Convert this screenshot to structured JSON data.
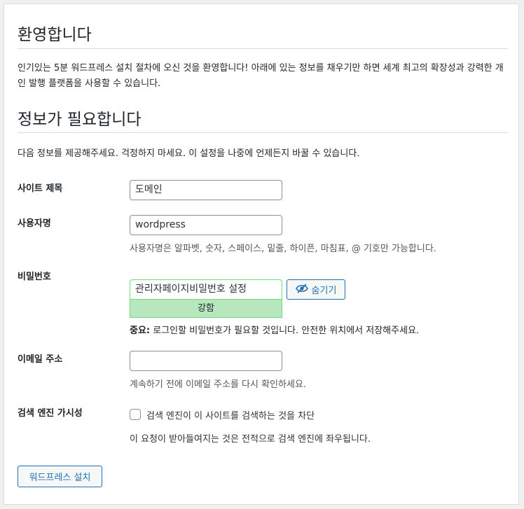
{
  "welcome": {
    "title": "환영합니다",
    "text": "인기있는 5분 워드프레스 설치 절차에 오신 것을 환영합니다! 아래에 있는 정보를 채우기만 하면 세계 최고의 확장성과 강력한 개인 발행 플랫폼을 사용할 수 있습니다."
  },
  "info": {
    "title": "정보가 필요합니다",
    "text": "다음 정보를 제공해주세요. 걱정하지 마세요. 이 설정을 나중에 언제든지 바꿀 수 있습니다."
  },
  "form": {
    "site_title": {
      "label": "사이트 제목",
      "value": "도메인"
    },
    "username": {
      "label": "사용자명",
      "value": "wordpress",
      "description": "사용자명은 알파벳, 숫자, 스페이스, 밑줄, 하이픈, 마침표, @ 기호만 가능합니다."
    },
    "password": {
      "label": "비밀번호",
      "value": "관리자페이지비밀번호 설정",
      "hide_label": "숨기기",
      "strength": "강함",
      "note_strong": "중요:",
      "note": " 로그인할 비밀번호가 필요할 것입니다. 안전한 위치에서 저장해주세요."
    },
    "email": {
      "label": "이메일 주소",
      "value": "",
      "description": "계속하기 전에 이메일 주소를 다시 확인하세요."
    },
    "visibility": {
      "label": "검색 엔진 가시성",
      "checkbox_label": "검색 엔진이 이 사이트를 검색하는 것을 차단",
      "checked": false,
      "description": "이 요청이 받아들여지는 것은 전적으로 검색 엔진에 좌우됩니다."
    }
  },
  "install_button": "워드프레스 설치",
  "colors": {
    "accent": "#2271b1",
    "strength_bg": "#b8e6bf",
    "strength_border": "#68de7c"
  },
  "icons": {
    "hide": "eye-slash-icon"
  }
}
